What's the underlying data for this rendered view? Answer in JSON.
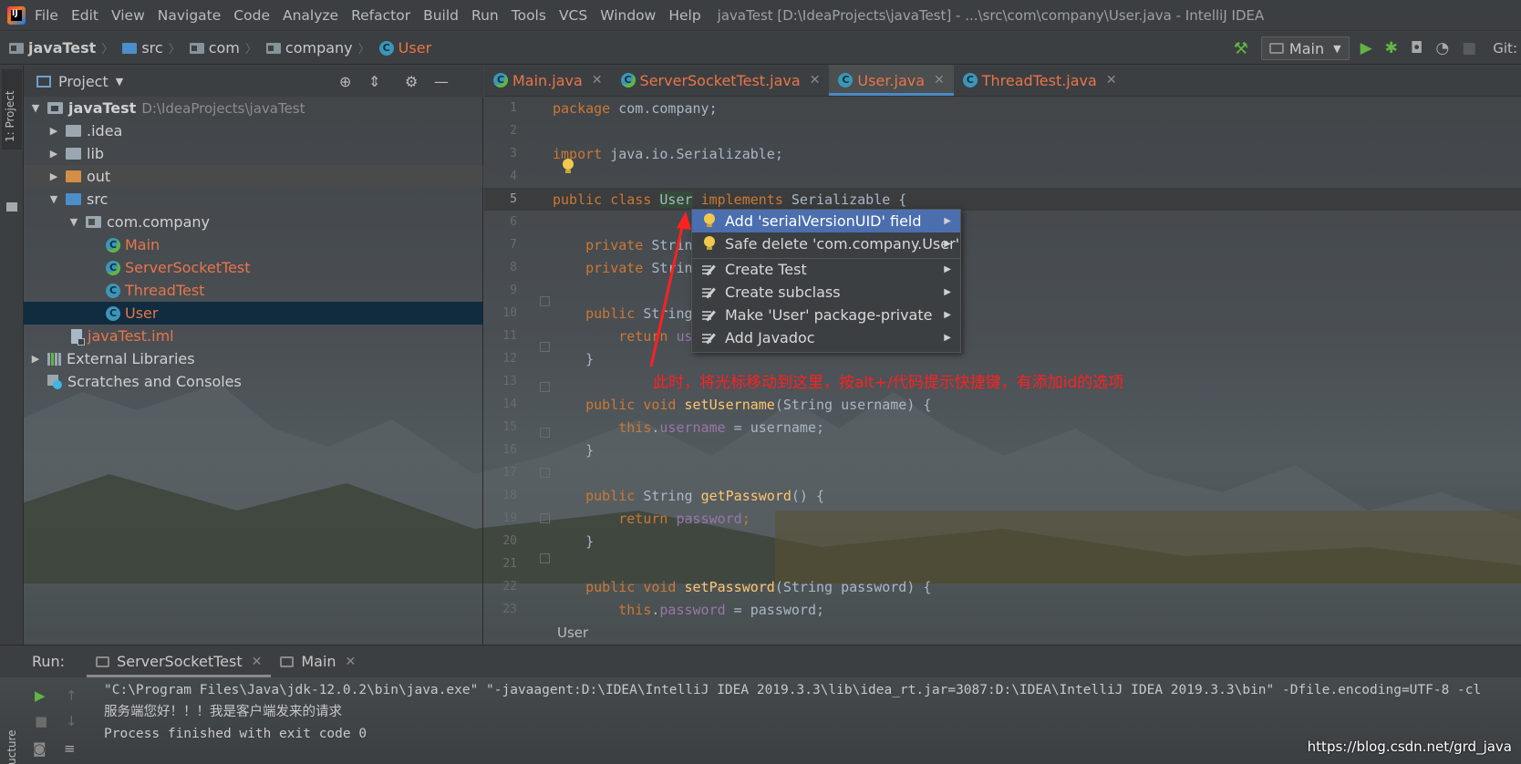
{
  "menu": {
    "items": [
      "File",
      "Edit",
      "View",
      "Navigate",
      "Code",
      "Analyze",
      "Refactor",
      "Build",
      "Run",
      "Tools",
      "VCS",
      "Window",
      "Help"
    ],
    "window_title": "javaTest [D:\\IdeaProjects\\javaTest] - ...\\src\\com\\company\\User.java - IntelliJ IDEA"
  },
  "navbar": {
    "crumbs": [
      "javaTest",
      "src",
      "com",
      "company",
      "User"
    ],
    "run_config": "Main",
    "git_label": "Git:"
  },
  "left_strip": {
    "project_tab": "1: Project",
    "structure_tab": "ucture"
  },
  "project": {
    "title": "Project",
    "tree": [
      {
        "label": "javaTest",
        "path": "D:\\IdeaProjects\\javaTest"
      },
      {
        "label": ".idea"
      },
      {
        "label": "lib"
      },
      {
        "label": "out"
      },
      {
        "label": "src"
      },
      {
        "label": "com.company"
      },
      {
        "label": "Main"
      },
      {
        "label": "ServerSocketTest"
      },
      {
        "label": "ThreadTest"
      },
      {
        "label": "User"
      },
      {
        "label": "javaTest.iml"
      },
      {
        "label": "External Libraries"
      },
      {
        "label": "Scratches and Consoles"
      }
    ]
  },
  "editor": {
    "tabs": [
      "Main.java",
      "ServerSocketTest.java",
      "User.java",
      "ThreadTest.java"
    ],
    "active_tab": "User.java",
    "line_numbers": [
      "1",
      "2",
      "3",
      "4",
      "5",
      "6",
      "7",
      "8",
      "9",
      "10",
      "11",
      "12",
      "13",
      "14",
      "15",
      "16",
      "17",
      "18",
      "19",
      "20",
      "21",
      "22",
      "23"
    ],
    "code": {
      "l1_kw": "package",
      "l1_rest": " com.company;",
      "l3_kw": "import",
      "l3_rest": " java.io.Serializable;",
      "l5_kw1": "public class",
      "l5_cls": "User",
      "l5_kw2": "implements",
      "l5_rest": " Serializable {",
      "l7_kw": "private",
      "l7_rest": " Strin",
      "l8_kw": "private",
      "l8_rest": " Strin",
      "l10_kw": "public",
      "l10_rest": " String",
      "l11_kw": "return",
      "l11_rest": " us",
      "l12": "}",
      "l14_kw": "public void",
      "l14_m": "setUsername",
      "l14_rest": "(String username) {",
      "l15_kw": "this",
      "l15_f": "username",
      "l15_rest": " = username;",
      "l16": "}",
      "l18_kw": "public",
      "l18_rest1": " String ",
      "l18_m": "getPassword",
      "l18_rest2": "() {",
      "l19_kw": "return",
      "l19_f": "password",
      "l20": "}",
      "l22_kw": "public void",
      "l22_m": "setPassword",
      "l22_rest": "(String password) {",
      "l23_kw": "this",
      "l23_f": "password",
      "l23_rest": " = password;"
    },
    "breadcrumb": "User"
  },
  "intention_menu": {
    "items": [
      "Add 'serialVersionUID' field",
      "Safe delete 'com.company.User'",
      "Create Test",
      "Create subclass",
      "Make 'User' package-private",
      "Add Javadoc"
    ],
    "selected": "Add 'serialVersionUID' field"
  },
  "annotation": "此时，将光标移动到这里，按alt+/代码提示快捷键，有添加id的选项",
  "run": {
    "label": "Run:",
    "tabs": [
      "ServerSocketTest",
      "Main"
    ],
    "active_tab": "ServerSocketTest",
    "console": [
      "\"C:\\Program Files\\Java\\jdk-12.0.2\\bin\\java.exe\" \"-javaagent:D:\\IDEA\\IntelliJ IDEA 2019.3.3\\lib\\idea_rt.jar=3087:D:\\IDEA\\IntelliJ IDEA 2019.3.3\\bin\" -Dfile.encoding=UTF-8 -cl",
      "服务端您好！！！我是客户端发来的请求",
      "",
      "Process finished with exit code 0"
    ]
  },
  "watermark": "https://blog.csdn.net/grd_java",
  "colors": {
    "background": "#3c3f41",
    "selection": "#4b6eaf",
    "keyword": "#cc7832",
    "class_name": "#e8754a",
    "annotation": "#ff2020"
  }
}
